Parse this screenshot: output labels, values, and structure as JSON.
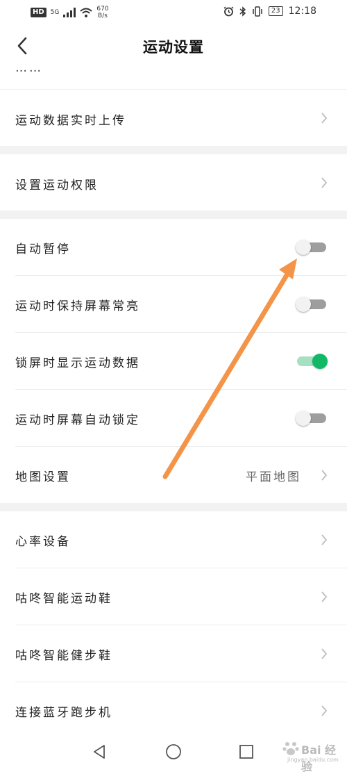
{
  "status_bar": {
    "hd": "HD",
    "signal_tag": "5G",
    "speed_value": "670",
    "speed_unit": "B/s",
    "battery": "23",
    "time": "12:18"
  },
  "header": {
    "title": "运动设置"
  },
  "partial_row": {
    "label": "……"
  },
  "rows": [
    {
      "label": "运动数据实时上传"
    },
    {
      "label": "设置运动权限"
    },
    {
      "label": "自动暂停",
      "toggle": false
    },
    {
      "label": "运动时保持屏幕常亮",
      "toggle": false
    },
    {
      "label": "锁屏时显示运动数据",
      "toggle": true
    },
    {
      "label": "运动时屏幕自动锁定",
      "toggle": false
    },
    {
      "label": "地图设置",
      "value": "平面地图"
    },
    {
      "label": "心率设备"
    },
    {
      "label": "咕咚智能运动鞋"
    },
    {
      "label": "咕咚智能健步鞋"
    },
    {
      "label": "连接蓝牙跑步机"
    }
  ],
  "watermark": {
    "text": "Bai 经验",
    "sub": "jingyan.baidu.com"
  },
  "colors": {
    "accent_green": "#12b866",
    "annotation_arrow": "#f39448",
    "section_gap": "#f2f2f2"
  }
}
